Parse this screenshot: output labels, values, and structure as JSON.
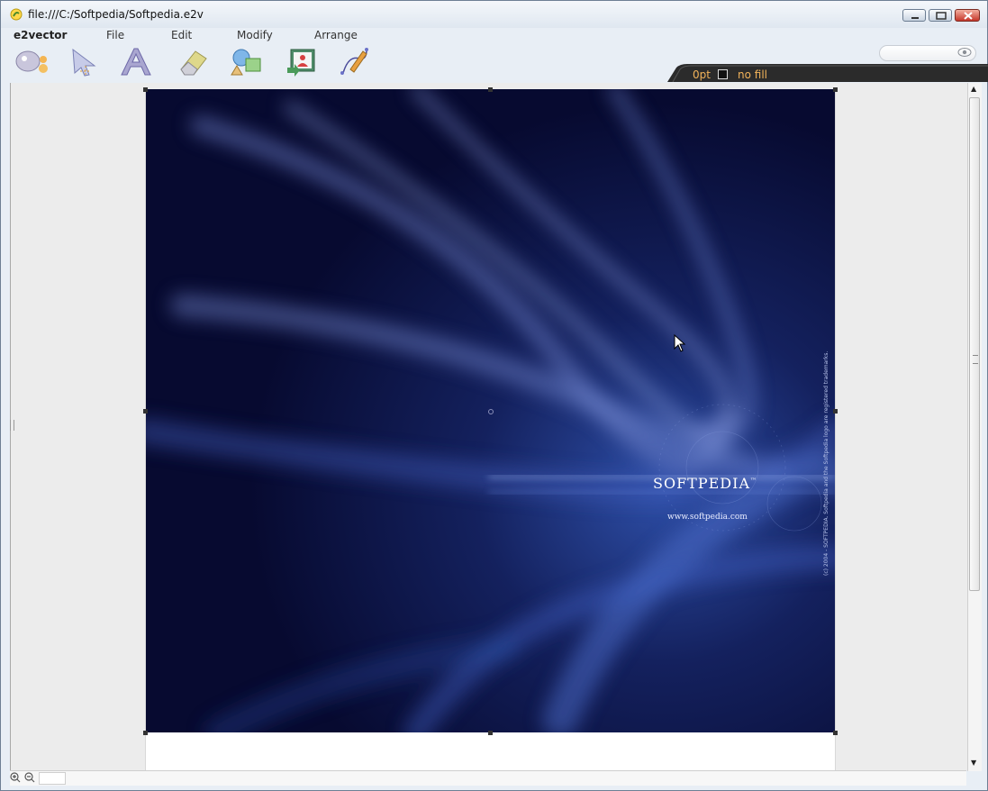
{
  "window": {
    "title": "file:///C:/Softpedia/Softpedia.e2v"
  },
  "menu": {
    "brand": "e2vector",
    "items": [
      "File",
      "Edit",
      "Modify",
      "Arrange"
    ]
  },
  "toolbar": {
    "tools": [
      {
        "icon": "palette-icon"
      },
      {
        "icon": "pointer-tool-icon"
      },
      {
        "icon": "text-tool-icon"
      },
      {
        "icon": "eraser-tool-icon"
      },
      {
        "icon": "shapes-tool-icon"
      },
      {
        "icon": "image-tool-icon"
      },
      {
        "icon": "pen-tool-icon"
      }
    ]
  },
  "properties": {
    "stroke_width": "0pt",
    "stroke_color": "#000000",
    "fill": "no fill"
  },
  "canvas": {
    "logo_text": "SOFTPEDIA",
    "logo_tm": "™",
    "url_text": "www.softpedia.com",
    "copyright_text": "(c) 2004 - SOFTPEDIA. Softpedia and the Softpedia logo are registered trademarks."
  },
  "colors": {
    "accent_orange": "#f2b35a",
    "artwork_dark": "#060a2e",
    "artwork_light": "#5a74c8"
  }
}
